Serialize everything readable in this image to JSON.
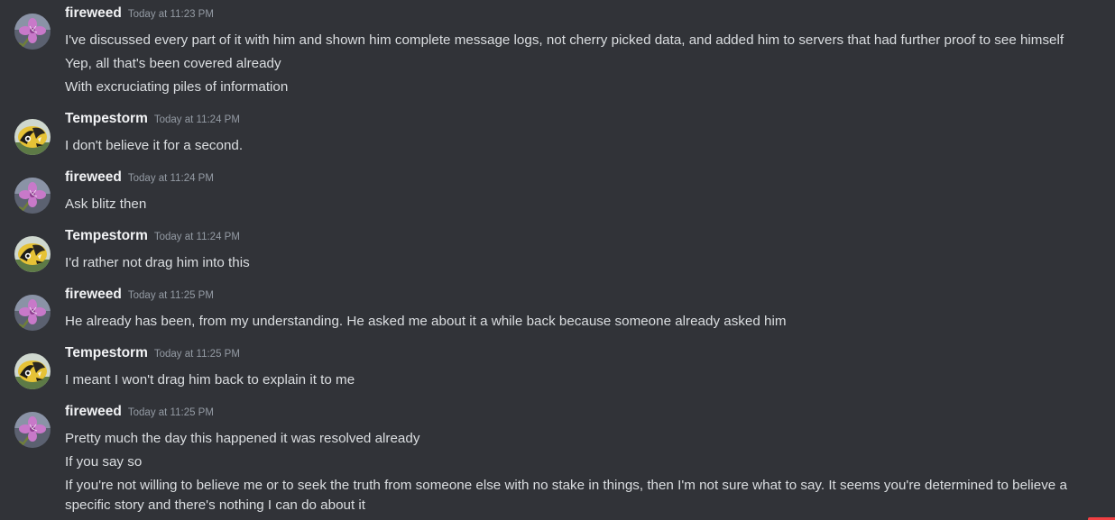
{
  "messages": [
    {
      "author": "fireweed",
      "avatar_icon": "fireweed-flower-avatar",
      "timestamp": "Today at 11:23 PM",
      "lines": [
        "I've discussed every part of it with him and shown him complete message logs, not cherry picked data, and added him to servers that had further proof to see himself",
        "Yep, all that's been covered already",
        "With excruciating piles of information"
      ]
    },
    {
      "author": "Tempestorm",
      "avatar_icon": "tempestorm-bird-avatar",
      "timestamp": "Today at 11:24 PM",
      "lines": [
        "I don't believe it for a second."
      ]
    },
    {
      "author": "fireweed",
      "avatar_icon": "fireweed-flower-avatar",
      "timestamp": "Today at 11:24 PM",
      "lines": [
        "Ask blitz then"
      ]
    },
    {
      "author": "Tempestorm",
      "avatar_icon": "tempestorm-bird-avatar",
      "timestamp": "Today at 11:24 PM",
      "lines": [
        "I'd rather not drag him into this"
      ]
    },
    {
      "author": "fireweed",
      "avatar_icon": "fireweed-flower-avatar",
      "timestamp": "Today at 11:25 PM",
      "lines": [
        "He already has been, from my understanding. He asked me about it a while back because someone already asked him"
      ]
    },
    {
      "author": "Tempestorm",
      "avatar_icon": "tempestorm-bird-avatar",
      "timestamp": "Today at 11:25 PM",
      "lines": [
        "I meant I won't drag him back to explain it to me"
      ]
    },
    {
      "author": "fireweed",
      "avatar_icon": "fireweed-flower-avatar",
      "timestamp": "Today at 11:25 PM",
      "lines": [
        "Pretty much the day this happened it was resolved already",
        "If you say so",
        "If you're not willing to believe me or to seek the truth from someone else with no stake in things, then I'm not sure what to say. It seems you're determined to believe a specific story and there's nothing I can do about it"
      ]
    }
  ]
}
